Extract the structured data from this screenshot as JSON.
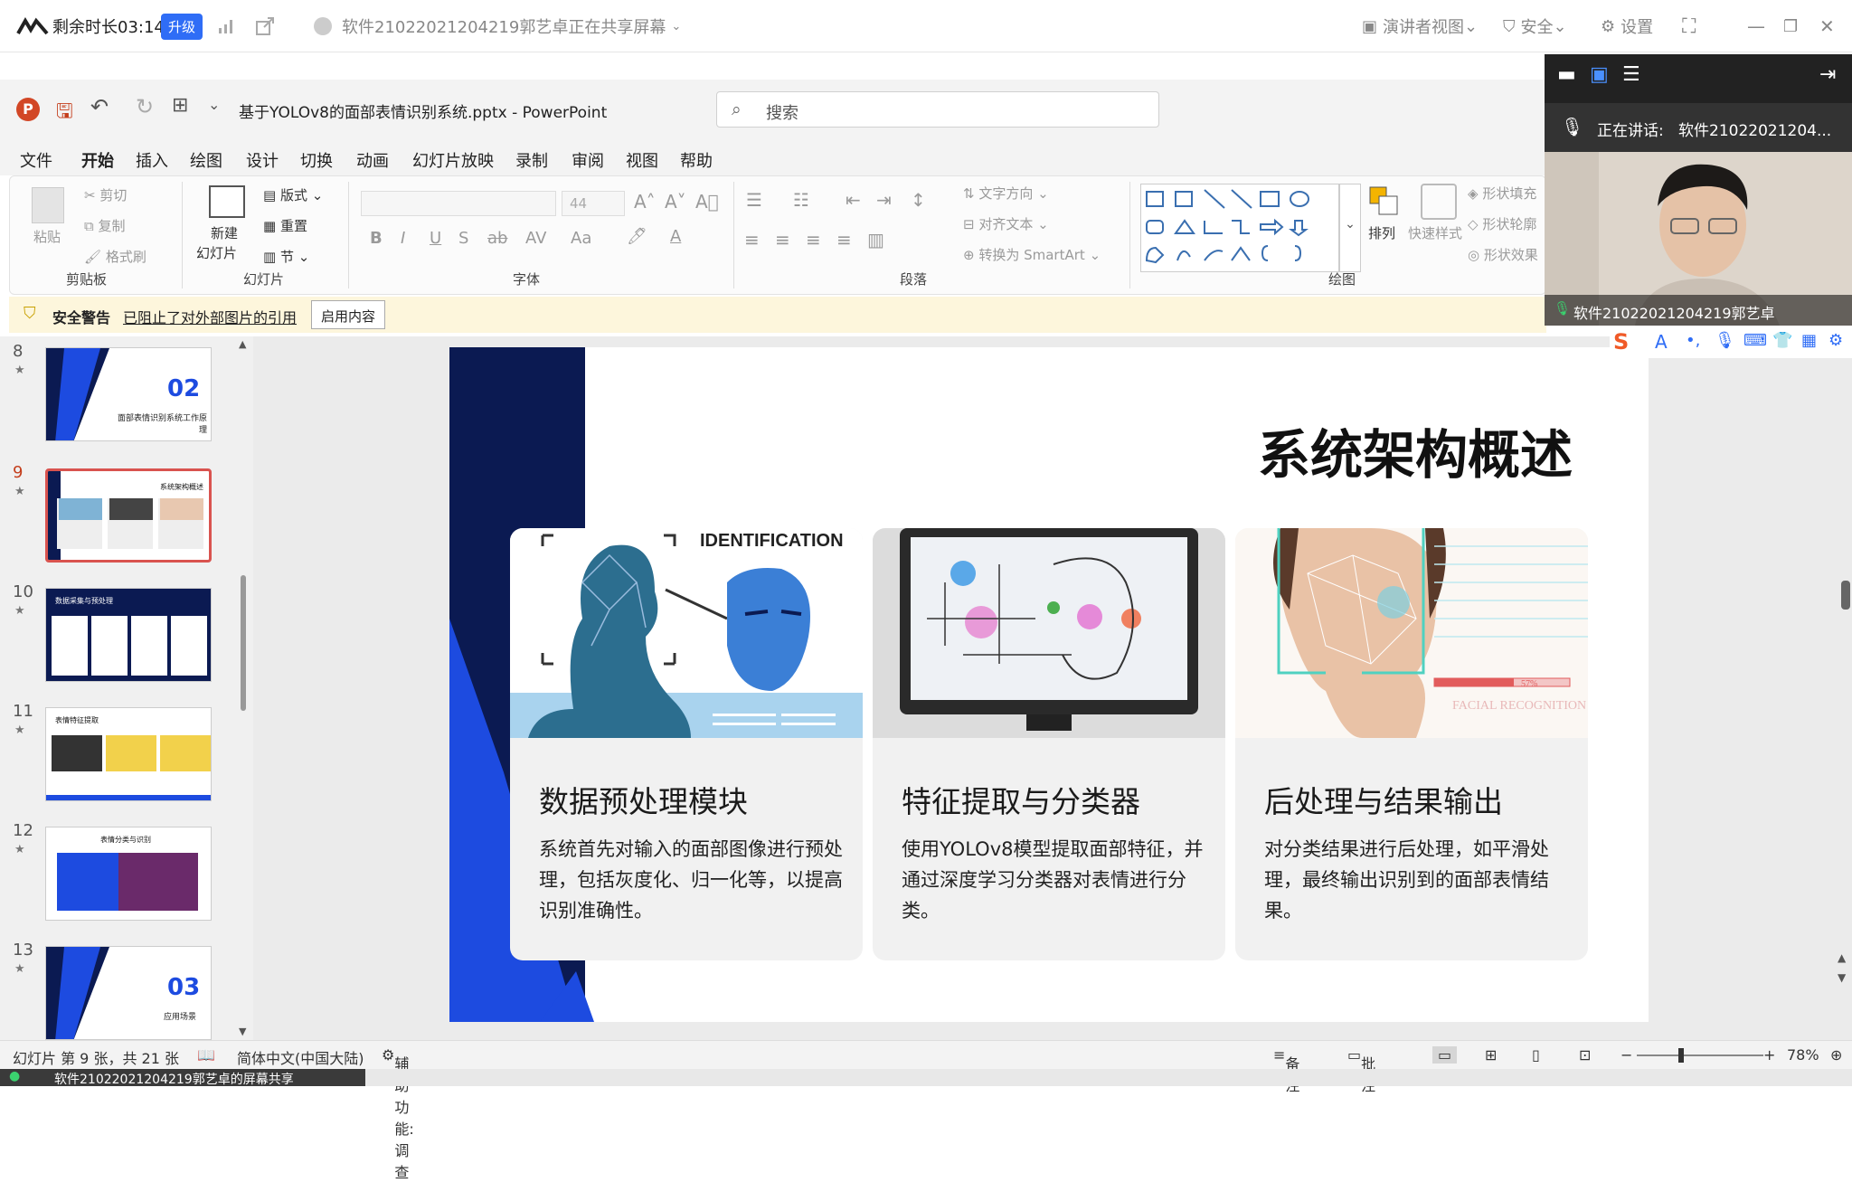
{
  "meeting": {
    "remaining": "剩余时长03:14",
    "upgrade": "升级",
    "sharing": "软件21022021204219郭艺卓正在共享屏幕",
    "presenter_view": "演讲者视图",
    "security": "安全",
    "settings": "设置"
  },
  "ppt": {
    "filename": "基于YOLOv8的面部表情识别系统.pptx",
    "sep": "-",
    "app": "PowerPoint",
    "search_placeholder": "搜索"
  },
  "menu": [
    "文件",
    "开始",
    "插入",
    "绘图",
    "设计",
    "切换",
    "动画",
    "幻灯片放映",
    "录制",
    "审阅",
    "视图",
    "帮助"
  ],
  "ribbon": {
    "clipboard": {
      "paste": "粘贴",
      "cut": "剪切",
      "copy": "复制",
      "format": "格式刷",
      "label": "剪贴板"
    },
    "slides": {
      "new": "新建",
      "new2": "幻灯片",
      "layout": "版式",
      "reset": "重置",
      "section": "节",
      "label": "幻灯片"
    },
    "font": {
      "size": "44",
      "label": "字体"
    },
    "paragraph": {
      "dir": "文字方向",
      "align": "对齐文本",
      "smartart": "转换为 SmartArt",
      "label": "段落"
    },
    "drawing": {
      "arrange": "排列",
      "quick": "快速样式",
      "fill": "形状填充",
      "outline": "形状轮廓",
      "effect": "形状效果",
      "label": "绘图"
    }
  },
  "warning": {
    "title": "安全警告",
    "text": "已阻止了对外部图片的引用",
    "button": "启用内容"
  },
  "thumbs": [
    {
      "num": "8",
      "title": "02",
      "sub": "面部表情识别系统工作原理"
    },
    {
      "num": "9",
      "title": "系统架构概述"
    },
    {
      "num": "10",
      "title": "数据采集与预处理"
    },
    {
      "num": "11",
      "title": "表情特征提取"
    },
    {
      "num": "12",
      "title": "表情分类与识别"
    },
    {
      "num": "13",
      "title": "03",
      "sub": "应用场景"
    }
  ],
  "slide": {
    "title": "系统架构概述",
    "ident": "IDENTIFICATION",
    "facial": "FACIAL RECOGNITION SYSTEM",
    "percent": "57%",
    "cards": [
      {
        "heading": "数据预处理模块",
        "body": "系统首先对输入的面部图像进行预处理，包括灰度化、归一化等，以提高识别准确性。"
      },
      {
        "heading": "特征提取与分类器",
        "body": "使用YOLOv8模型提取面部特征，并通过深度学习分类器对表情进行分类。"
      },
      {
        "heading": "后处理与结果输出",
        "body": "对分类结果进行后处理，如平滑处理，最终输出识别到的面部表情结果。"
      }
    ]
  },
  "video": {
    "speaking": "正在讲话:",
    "speaker": "软件21022021204...",
    "name": "软件21022021204219郭艺卓"
  },
  "status": {
    "slide_info": "幻灯片 第 9 张，共 21 张",
    "lang": "简体中文(中国大陆)",
    "access": "辅助功能: 调查",
    "notes": "备注",
    "comments": "批注",
    "zoom": "78%"
  },
  "taskbar": {
    "text": "软件21022021204219郭艺卓的屏幕共享"
  }
}
